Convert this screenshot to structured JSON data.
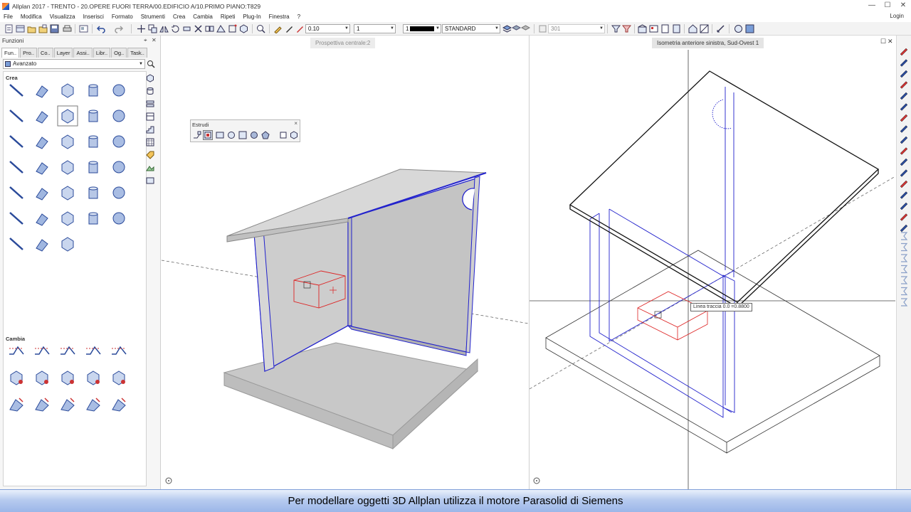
{
  "window": {
    "title": "Allplan 2017 - TRENTO - 20.OPERE FUORI TERRA/00.EDIFICIO A/10.PRIMO PIANO:T829",
    "minimize": "—",
    "maximize": "☐",
    "close": "✕"
  },
  "menu": {
    "items": [
      "File",
      "Modifica",
      "Visualizza",
      "Inserisci",
      "Formato",
      "Strumenti",
      "Crea",
      "Cambia",
      "Ripeti",
      "Plug-In",
      "Finestra",
      "?"
    ],
    "login": "Login"
  },
  "toolbar": {
    "pen_thickness": "0.10",
    "line_type": "1",
    "color_number": "1",
    "layer": "STANDARD",
    "drawing_file": "301"
  },
  "panel": {
    "title": "Funzioni",
    "tabs": [
      "Fun..",
      "Pro..",
      "Co..",
      "Layer",
      "Assi..",
      "Libr..",
      "Og..",
      "Task.."
    ],
    "mode": "Avanzato",
    "section_create": "Crea",
    "section_modify": "Cambia"
  },
  "palette": {
    "title": "Estrudi",
    "close": "×"
  },
  "viewports": {
    "left_label": "Prospettiva centrale:2",
    "right_label": "Isometria anteriore sinistra, Sud-Ovest 1",
    "right_maximize": "☐",
    "right_close": "✕"
  },
  "tooltip": {
    "text": "Linea traccia 0.0   =0.8800"
  },
  "caption": {
    "text": "Per modellare oggetti 3D Allplan utilizza il motore Parasolid di Siemens"
  },
  "colors": {
    "selection_blue": "#2222cc",
    "construction_red": "#dd2222",
    "solid_gray": "#c8c8c8",
    "caption_blue": "#a9c1ee"
  }
}
